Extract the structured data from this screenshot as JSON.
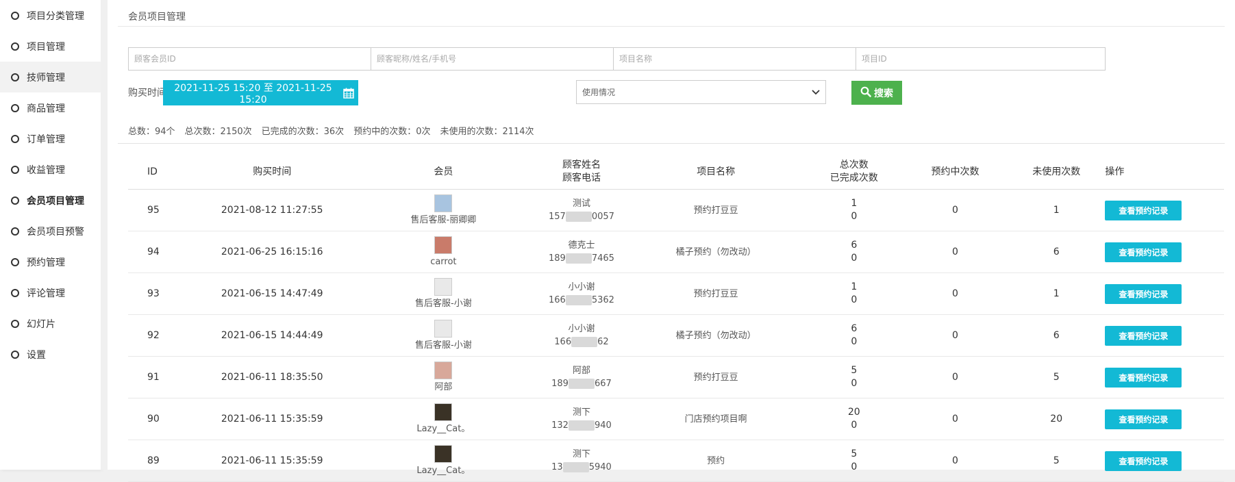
{
  "sidebar": {
    "items": [
      {
        "label": "项目分类管理",
        "state": ""
      },
      {
        "label": "项目管理",
        "state": ""
      },
      {
        "label": "技师管理",
        "state": "hover"
      },
      {
        "label": "商品管理",
        "state": ""
      },
      {
        "label": "订单管理",
        "state": ""
      },
      {
        "label": "收益管理",
        "state": ""
      },
      {
        "label": "会员项目管理",
        "state": "active"
      },
      {
        "label": "会员项目预警",
        "state": ""
      },
      {
        "label": "预约管理",
        "state": ""
      },
      {
        "label": "评论管理",
        "state": ""
      },
      {
        "label": "幻灯片",
        "state": ""
      },
      {
        "label": "设置",
        "state": ""
      }
    ]
  },
  "page": {
    "title": "会员项目管理"
  },
  "filters": {
    "member_id_placeholder": "顾客会员ID",
    "nickname_placeholder": "顾客昵称/姓名/手机号",
    "project_name_placeholder": "项目名称",
    "project_id_placeholder": "项目ID",
    "buy_time_label": "购买时间",
    "date_range": "2021-11-25 15:20 至 2021-11-25 15:20",
    "usage_select": "使用情况",
    "search_label": "搜索"
  },
  "stats": {
    "total": "总数：94个",
    "total_times": "总次数：2150次",
    "done_times": "已完成的次数：36次",
    "booking_times": "预约中的次数：0次",
    "unused_times": "未使用的次数：2114次"
  },
  "table": {
    "headers": {
      "id": "ID",
      "buy_time": "购买时间",
      "member": "会员",
      "customer_name": "顾客姓名",
      "customer_phone": "顾客电话",
      "project_name": "项目名称",
      "total_times": "总次数",
      "done_times": "已完成次数",
      "booking_times": "预约中次数",
      "unused_times": "未使用次数",
      "action": "操作"
    },
    "rows": [
      {
        "id": "95",
        "time": "2021-08-12 11:27:55",
        "member": "售后客服-丽卿卿",
        "name": "测试",
        "phone_a": "157",
        "phone_b": "0057",
        "project": "预约打豆豆",
        "total": "1",
        "done": "0",
        "booking": "0",
        "unused": "1",
        "action": "查看预约记录",
        "avatar": "#a8c4e0"
      },
      {
        "id": "94",
        "time": "2021-06-25 16:15:16",
        "member": "carrot",
        "name": "德克士",
        "phone_a": "189",
        "phone_b": "7465",
        "project": "橘子预约（勿改动）",
        "total": "6",
        "done": "0",
        "booking": "0",
        "unused": "6",
        "action": "查看预约记录",
        "avatar": "#c97b6a"
      },
      {
        "id": "93",
        "time": "2021-06-15 14:47:49",
        "member": "售后客服-小谢",
        "name": "小小谢",
        "phone_a": "166",
        "phone_b": "5362",
        "project": "预约打豆豆",
        "total": "1",
        "done": "0",
        "booking": "0",
        "unused": "1",
        "action": "查看预约记录",
        "avatar": "#e9e9e9"
      },
      {
        "id": "92",
        "time": "2021-06-15 14:44:49",
        "member": "售后客服-小谢",
        "name": "小小谢",
        "phone_a": "166",
        "phone_b": "62",
        "project": "橘子预约（勿改动）",
        "total": "6",
        "done": "0",
        "booking": "0",
        "unused": "6",
        "action": "查看预约记录",
        "avatar": "#e9e9e9"
      },
      {
        "id": "91",
        "time": "2021-06-11 18:35:50",
        "member": "阿部",
        "name": "阿部",
        "phone_a": "189",
        "phone_b": "667",
        "project": "预约打豆豆",
        "total": "5",
        "done": "0",
        "booking": "0",
        "unused": "5",
        "action": "查看预约记录",
        "avatar": "#d8a89a"
      },
      {
        "id": "90",
        "time": "2021-06-11 15:35:59",
        "member": "Lazy__Cat。",
        "name": "测下",
        "phone_a": "132",
        "phone_b": "940",
        "project": "门店预约项目啊",
        "total": "20",
        "done": "0",
        "booking": "0",
        "unused": "20",
        "action": "查看预约记录",
        "avatar": "#3a3226"
      },
      {
        "id": "89",
        "time": "2021-06-11 15:35:59",
        "member": "Lazy__Cat。",
        "name": "测下",
        "phone_a": "13",
        "phone_b": "5940",
        "project": "预约",
        "total": "5",
        "done": "0",
        "booking": "0",
        "unused": "5",
        "action": "查看预约记录",
        "avatar": "#3a3226"
      }
    ]
  }
}
